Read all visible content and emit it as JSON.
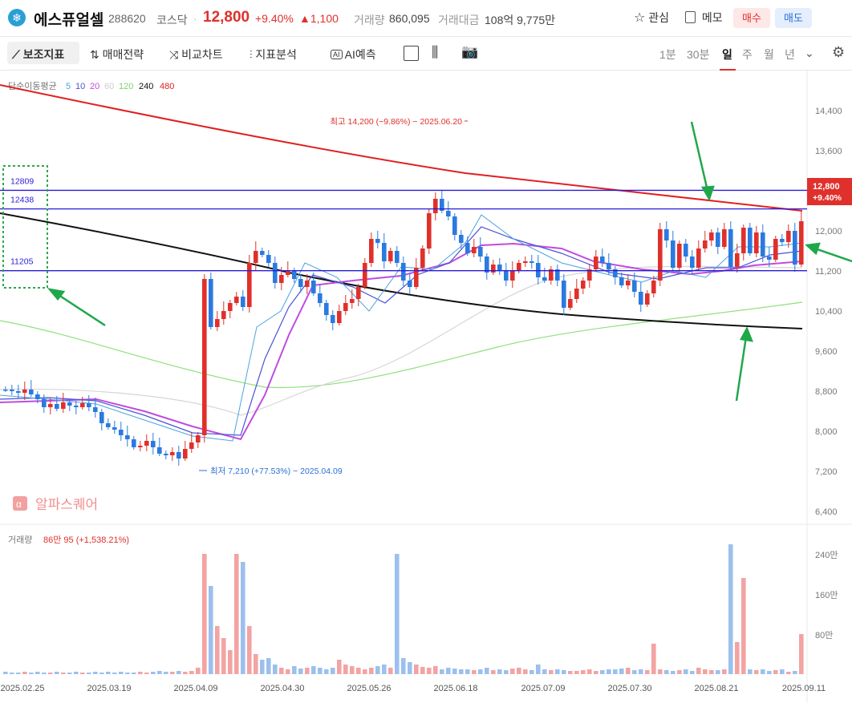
{
  "header": {
    "logo_icon": "snowflake-logo-icon",
    "name": "에스퓨얼셀",
    "code": "288620",
    "market": "코스닥",
    "price": "12,800",
    "change_pct": "+9.40%",
    "change_amt": "▲1,100",
    "volume_label": "거래량",
    "volume": "860,095",
    "value_label": "거래대금",
    "value": "108억 9,775만",
    "watch_label": "관심",
    "memo_label": "메모",
    "buy_label": "매수",
    "sell_label": "매도"
  },
  "toolbar": {
    "items": [
      "보조지표",
      "매매전략",
      "비교차트",
      "지표분석",
      "AI예측"
    ],
    "periods": [
      "1분",
      "30분",
      "일",
      "주",
      "월",
      "년"
    ],
    "selected_period": "일"
  },
  "chart_data": {
    "type": "candlestick",
    "ma_legend": {
      "label": "단순이동평균",
      "periods": [
        "5",
        "10",
        "20",
        "60",
        "120",
        "240",
        "480"
      ],
      "colors": [
        "#4aa3e0",
        "#4b52d6",
        "#c04be0",
        "#cccccc",
        "#7bd66a",
        "#111111",
        "#e02020"
      ]
    },
    "y_ticks": [
      "14,400",
      "13,600",
      "12,800",
      "12,000",
      "11,200",
      "10,400",
      "9,600",
      "8,800",
      "8,000",
      "7,200",
      "6,400"
    ],
    "ylim": [
      6400,
      14800
    ],
    "x_ticks": [
      "2025.02.25",
      "2025.03.19",
      "2025.04.09",
      "2025.04.30",
      "2025.05.26",
      "2025.06.18",
      "2025.07.09",
      "2025.07.30",
      "2025.08.21",
      "2025.09.11"
    ],
    "last_price_label": "12,800",
    "last_change_label": "+9.40%",
    "high_annotation": "최고 14,200 (−9.86%) − 2025.06.20",
    "low_annotation": "최저 7,210 (+77.53%) − 2025.04.09",
    "levels": [
      {
        "label": "12809",
        "value": 12809
      },
      {
        "label": "12438",
        "value": 12438
      },
      {
        "label": "11205",
        "value": 11205
      }
    ],
    "watermark": "알파스퀘어",
    "volume_panel": {
      "label": "거래량",
      "value_label": "86만 95 (+1,538.21%)",
      "y_ticks": [
        "240만",
        "160만",
        "80만"
      ]
    }
  }
}
